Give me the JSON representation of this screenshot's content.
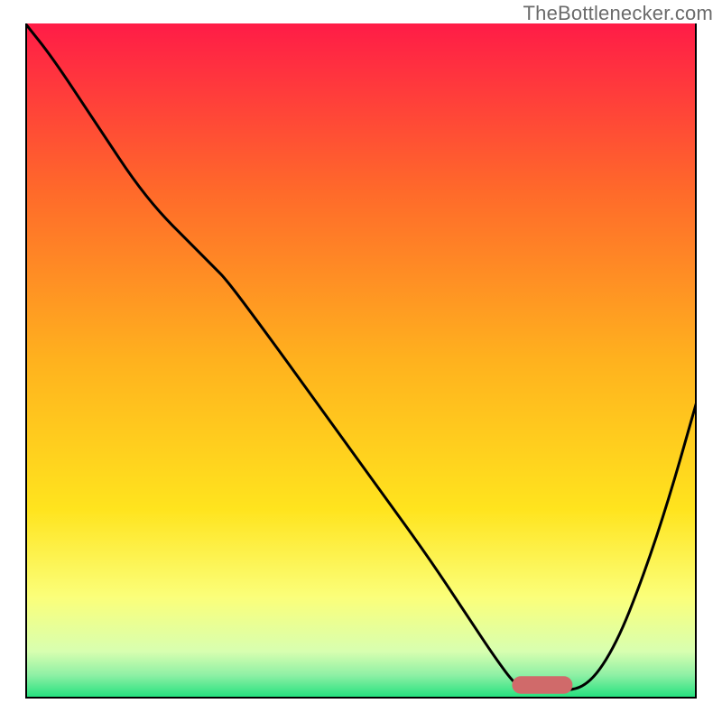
{
  "watermark": "TheBottlenecker.com",
  "chart_data": {
    "type": "line",
    "title": "",
    "xlabel": "",
    "ylabel": "",
    "xlim": [
      0,
      100
    ],
    "ylim": [
      0,
      100
    ],
    "grid": false,
    "legend": false,
    "annotations": [],
    "background": {
      "type": "vertical-gradient",
      "stops": [
        {
          "pos": 0.0,
          "color": "#ff1c47"
        },
        {
          "pos": 0.25,
          "color": "#ff6a2a"
        },
        {
          "pos": 0.5,
          "color": "#ffb21e"
        },
        {
          "pos": 0.72,
          "color": "#ffe41e"
        },
        {
          "pos": 0.85,
          "color": "#fbff7a"
        },
        {
          "pos": 0.93,
          "color": "#d8ffb0"
        },
        {
          "pos": 0.965,
          "color": "#8ff0a5"
        },
        {
          "pos": 1.0,
          "color": "#1ee07c"
        }
      ]
    },
    "series": [
      {
        "name": "curve",
        "color": "#000000",
        "x": [
          0,
          4,
          10,
          18,
          26,
          28,
          30,
          36,
          44,
          52,
          60,
          66,
          70,
          73,
          75,
          80,
          84,
          88,
          92,
          96,
          100
        ],
        "y": [
          100,
          95,
          86,
          74,
          66,
          64,
          62,
          54,
          43,
          32,
          21,
          12,
          6,
          2,
          1,
          1,
          2,
          8,
          18,
          30,
          44
        ]
      }
    ],
    "markers": [
      {
        "name": "optimum-band",
        "type": "capsule",
        "x_center": 77,
        "y_center": 2,
        "width": 9,
        "height": 2.6,
        "color": "#d06a6a"
      }
    ]
  }
}
